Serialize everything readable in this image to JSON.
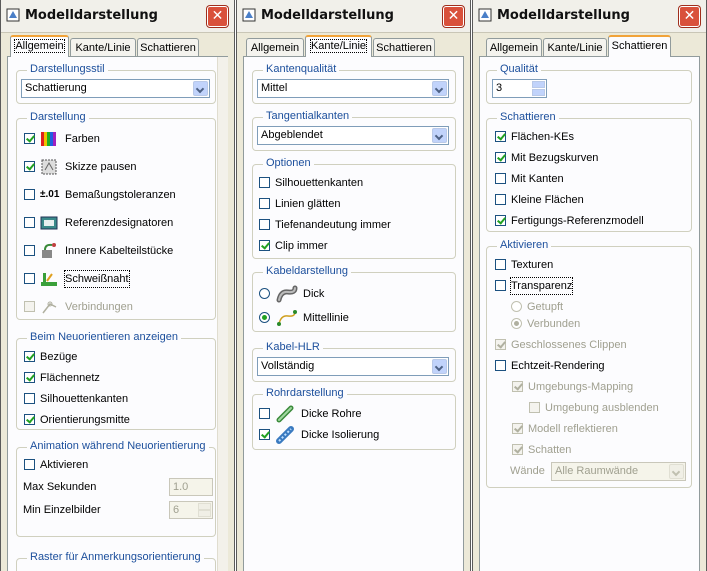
{
  "window_title": "Modelldarstellung",
  "close_glyph": "✕",
  "tabs": [
    "Allgemein",
    "Kante/Linie",
    "Schattieren"
  ],
  "panel1": {
    "darstellungsstil": {
      "legend": "Darstellungsstil",
      "value": "Schattierung"
    },
    "darstellung": {
      "legend": "Darstellung",
      "items": [
        {
          "label": "Farben",
          "checked": true,
          "icon": "color-bars-icon"
        },
        {
          "label": "Skizze pausen",
          "checked": true,
          "icon": "sketch-trace-icon"
        },
        {
          "label": "Bemaßungstoleranzen",
          "checked": false,
          "icon": "tolerance-icon",
          "icon_text": "±.01"
        },
        {
          "label": "Referenzdesignatoren",
          "checked": false,
          "icon": "reference-designator-icon"
        },
        {
          "label": "Innere Kabelteilstücke",
          "checked": false,
          "icon": "cable-piece-icon"
        },
        {
          "label": "Schweißnaht",
          "checked": false,
          "icon": "weld-icon"
        },
        {
          "label": "Verbindungen",
          "checked": false,
          "icon": "connection-icon",
          "disabled": true
        }
      ]
    },
    "neuorientieren": {
      "legend": "Beim Neuorientieren anzeigen",
      "items": [
        {
          "label": "Bezüge",
          "checked": true
        },
        {
          "label": "Flächennetz",
          "checked": true
        },
        {
          "label": "Silhouettenkanten",
          "checked": false
        },
        {
          "label": "Orientierungsmitte",
          "checked": true
        }
      ]
    },
    "animation": {
      "legend": "Animation während Neuorientierung",
      "aktivieren": "Aktivieren",
      "max_sekunden_label": "Max Sekunden",
      "max_sekunden_value": "1.0",
      "min_einzelbilder_label": "Min Einzelbilder",
      "min_einzelbilder_value": "6"
    },
    "raster": {
      "legend": "Raster für Anmerkungsorientierung"
    }
  },
  "panel2": {
    "kantenqualitaet": {
      "legend": "Kantenqualität",
      "value": "Mittel"
    },
    "tangentialkanten": {
      "legend": "Tangentialkanten",
      "value": "Abgeblendet"
    },
    "optionen": {
      "legend": "Optionen",
      "items": [
        {
          "label": "Silhouettenkanten",
          "checked": false
        },
        {
          "label": "Linien glätten",
          "checked": false
        },
        {
          "label": "Tiefenandeutung immer",
          "checked": false
        },
        {
          "label": "Clip immer",
          "checked": true
        }
      ]
    },
    "kabeldarstellung": {
      "legend": "Kabeldarstellung",
      "items": [
        {
          "label": "Dick",
          "selected": false,
          "icon": "thick-cable-icon"
        },
        {
          "label": "Mittellinie",
          "selected": true,
          "icon": "centerline-cable-icon"
        }
      ]
    },
    "kabel_hlr": {
      "legend": "Kabel-HLR",
      "value": "Vollständig"
    },
    "rohrdarstellung": {
      "legend": "Rohrdarstellung",
      "items": [
        {
          "label": "Dicke Rohre",
          "checked": false,
          "icon": "thick-pipe-icon"
        },
        {
          "label": "Dicke Isolierung",
          "checked": true,
          "icon": "thick-insulation-icon"
        }
      ]
    }
  },
  "panel3": {
    "qualitaet": {
      "legend": "Qualität",
      "value": "3"
    },
    "schattieren": {
      "legend": "Schattieren",
      "items": [
        {
          "label": "Flächen-KEs",
          "checked": true
        },
        {
          "label": "Mit Bezugskurven",
          "checked": true
        },
        {
          "label": "Mit Kanten",
          "checked": false
        },
        {
          "label": "Kleine Flächen",
          "checked": false
        },
        {
          "label": "Fertigungs-Referenzmodell",
          "checked": true
        }
      ]
    },
    "aktivieren": {
      "legend": "Aktivieren",
      "texturen": "Texturen",
      "transparenz": "Transparenz",
      "getupft": "Getupft",
      "verbunden": "Verbunden",
      "geschlossenes_clippen": "Geschlossenes Clippen",
      "echtzeit_rendering": "Echtzeit-Rendering",
      "umgebungs_mapping": "Umgebungs-Mapping",
      "umgebung_ausblenden": "Umgebung ausblenden",
      "modell_reflektieren": "Modell reflektieren",
      "schatten": "Schatten",
      "waende_label": "Wände",
      "waende_value": "Alle Raumwände"
    }
  }
}
